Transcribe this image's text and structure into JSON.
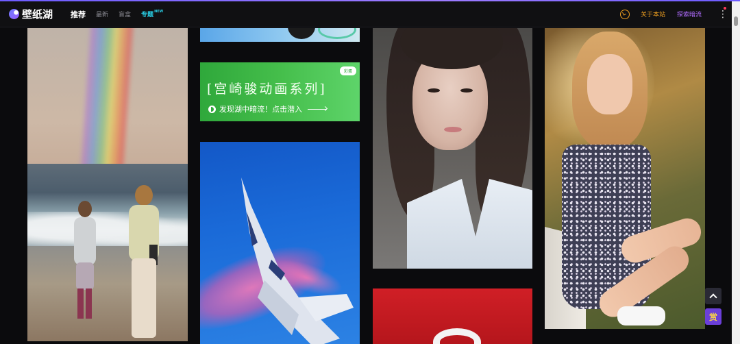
{
  "header": {
    "logo_text": "壁纸湖",
    "nav": [
      {
        "label": "推荐",
        "active": true
      },
      {
        "label": "最新"
      },
      {
        "label": "盲盒"
      },
      {
        "label": "专题",
        "badge": "NEW"
      }
    ],
    "about_label": "关于本站",
    "explore_label": "探索暗流",
    "more_glyph": "⋮"
  },
  "cards": {
    "miyazaki": {
      "tag": "彩蛋",
      "title": "[宫崎骏动画系列]",
      "subtitle": "发现湖中暗流！点击潜入"
    }
  },
  "floating": {
    "reward_label": "赏"
  },
  "icons": {
    "logo": "logo-mark-icon",
    "clock": "clock-icon",
    "more": "more-vertical-icon",
    "back_to_top": "chevron-up-icon"
  },
  "colors": {
    "accent_orange": "#f0a020",
    "accent_purple": "#b06cff",
    "accent_cyan": "#2ad1e8",
    "reward_bg": "#6b3fd9"
  }
}
